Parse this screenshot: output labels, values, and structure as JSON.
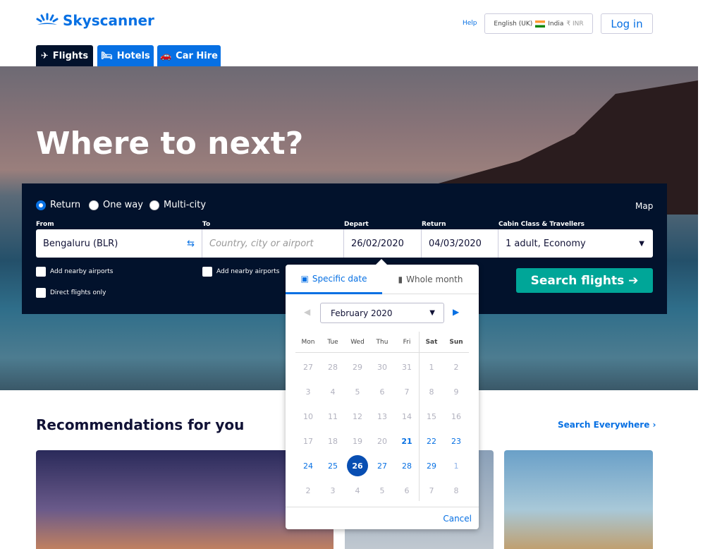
{
  "header": {
    "brand": "Skyscanner",
    "help": "Help",
    "language": "English (UK)",
    "country": "India",
    "currency": "₹ INR",
    "login": "Log in"
  },
  "tabs": [
    {
      "label": "Flights",
      "icon": "plane-icon",
      "active": true
    },
    {
      "label": "Hotels",
      "icon": "bed-icon"
    },
    {
      "label": "Car Hire",
      "icon": "car-icon"
    }
  ],
  "hero": {
    "title": "Where to next?"
  },
  "search": {
    "trip_types": [
      "Return",
      "One way",
      "Multi-city"
    ],
    "selected_trip": "Return",
    "map": "Map",
    "from_label": "From",
    "from_value": "Bengaluru (BLR)",
    "to_label": "To",
    "to_placeholder": "Country, city or airport",
    "depart_label": "Depart",
    "depart_value": "26/02/2020",
    "return_label": "Return",
    "return_value": "04/03/2020",
    "cabin_label": "Cabin Class & Travellers",
    "cabin_value": "1 adult, Economy",
    "nearby_from": "Add nearby airports",
    "nearby_to": "Add nearby airports",
    "direct": "Direct flights only",
    "submit": "Search flights"
  },
  "calendar": {
    "tab_specific": "Specific date",
    "tab_month": "Whole month",
    "month": "February 2020",
    "weekdays": [
      "Mon",
      "Tue",
      "Wed",
      "Thu",
      "Fri",
      "Sat",
      "Sun"
    ],
    "weeks": [
      [
        "27",
        "28",
        "29",
        "30",
        "31",
        "1",
        "2"
      ],
      [
        "3",
        "4",
        "5",
        "6",
        "7",
        "8",
        "9"
      ],
      [
        "10",
        "11",
        "12",
        "13",
        "14",
        "15",
        "16"
      ],
      [
        "17",
        "18",
        "19",
        "20",
        "21",
        "22",
        "23"
      ],
      [
        "24",
        "25",
        "26",
        "27",
        "28",
        "29",
        "1"
      ],
      [
        "2",
        "3",
        "4",
        "5",
        "6",
        "7",
        "8"
      ]
    ],
    "selected": "26",
    "today": "21",
    "cancel": "Cancel",
    "accent": "#0770e3"
  },
  "recommendations": {
    "title": "Recommendations for you",
    "link": "Search Everywhere"
  }
}
